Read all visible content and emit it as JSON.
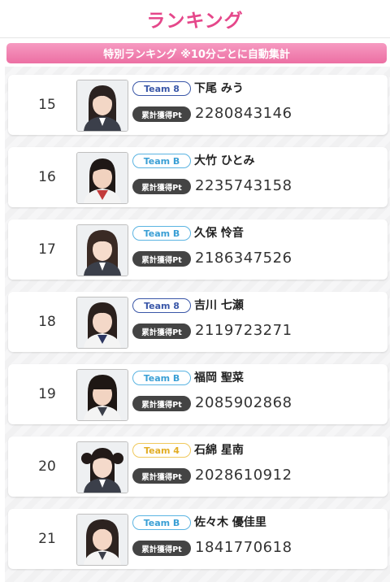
{
  "header": {
    "title": "ランキング"
  },
  "banner": {
    "text": "特別ランキング ※10分ごとに自動集計"
  },
  "points_label": "累計獲得Pt",
  "rows": [
    {
      "rank": "15",
      "team": "Team 8",
      "team_style": "team8",
      "name": "下尾 みう",
      "points": "2280843146"
    },
    {
      "rank": "16",
      "team": "Team B",
      "team_style": "teamB",
      "name": "大竹 ひとみ",
      "points": "2235743158"
    },
    {
      "rank": "17",
      "team": "Team B",
      "team_style": "teamB",
      "name": "久保 怜音",
      "points": "2186347526"
    },
    {
      "rank": "18",
      "team": "Team 8",
      "team_style": "team8",
      "name": "吉川 七瀬",
      "points": "2119723271"
    },
    {
      "rank": "19",
      "team": "Team B",
      "team_style": "teamB",
      "name": "福岡 聖菜",
      "points": "2085902868"
    },
    {
      "rank": "20",
      "team": "Team 4",
      "team_style": "team4",
      "name": "石綿 星南",
      "points": "2028610912"
    },
    {
      "rank": "21",
      "team": "Team B",
      "team_style": "teamB",
      "name": "佐々木 優佳里",
      "points": "1841770618"
    }
  ],
  "colors": {
    "title": "#e5478a",
    "banner": "#ec6fa3",
    "team8": "#3a57a8",
    "teamB": "#5bb4e2",
    "team4": "#f0c95c"
  }
}
